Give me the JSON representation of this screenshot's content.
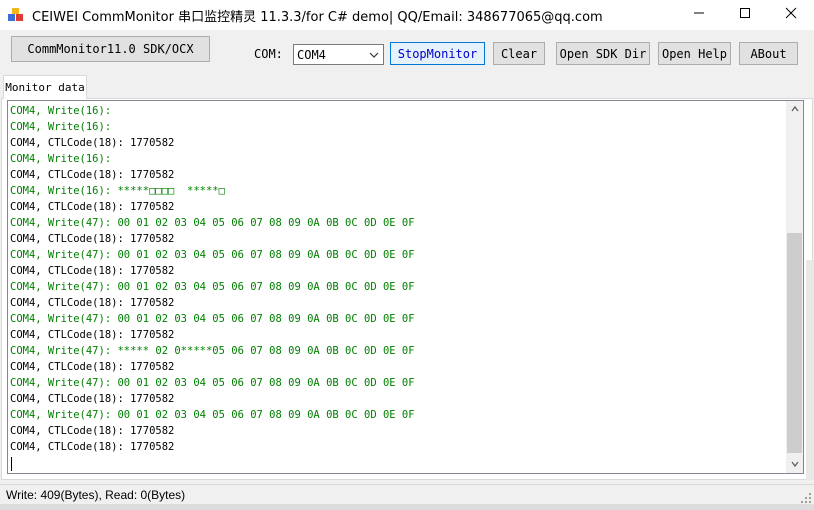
{
  "window": {
    "title": "CEIWEI CommMonitor 串口监控精灵 11.3.3/for C# demo| QQ/Email: 348677065@qq.com",
    "controls": [
      "minimize-icon",
      "maximize-icon",
      "close-icon"
    ]
  },
  "toolbar": {
    "sdk_label": "CommMonitor11.0 SDK/OCX",
    "com_label": "COM:",
    "com_value": "COM4",
    "stop_label": "StopMonitor",
    "clear_label": "Clear",
    "open_sdk_label": "Open SDK Dir",
    "help_label": "Open Help",
    "about_label": "ABout"
  },
  "tabs": [
    {
      "label": "Monitor data",
      "selected": true
    }
  ],
  "log": {
    "colors": {
      "write": "#008000",
      "ctl": "#000000"
    },
    "lines": [
      {
        "text": "COM4, Write(16):",
        "type": "write"
      },
      {
        "text": "COM4, Write(16):",
        "type": "write"
      },
      {
        "text": "COM4, CTLCode(18): 1770582",
        "type": "ctl"
      },
      {
        "text": "COM4, Write(16):",
        "type": "write"
      },
      {
        "text": "COM4, CTLCode(18): 1770582",
        "type": "ctl"
      },
      {
        "text": "COM4, Write(16): *****□□□□  *****□",
        "type": "write"
      },
      {
        "text": "COM4, CTLCode(18): 1770582",
        "type": "ctl"
      },
      {
        "text": "COM4, Write(47): 00 01 02 03 04 05 06 07 08 09 0A 0B 0C 0D 0E 0F",
        "type": "write"
      },
      {
        "text": "COM4, CTLCode(18): 1770582",
        "type": "ctl"
      },
      {
        "text": "COM4, Write(47): 00 01 02 03 04 05 06 07 08 09 0A 0B 0C 0D 0E 0F",
        "type": "write"
      },
      {
        "text": "COM4, CTLCode(18): 1770582",
        "type": "ctl"
      },
      {
        "text": "COM4, Write(47): 00 01 02 03 04 05 06 07 08 09 0A 0B 0C 0D 0E 0F",
        "type": "write"
      },
      {
        "text": "COM4, CTLCode(18): 1770582",
        "type": "ctl"
      },
      {
        "text": "COM4, Write(47): 00 01 02 03 04 05 06 07 08 09 0A 0B 0C 0D 0E 0F",
        "type": "write"
      },
      {
        "text": "COM4, CTLCode(18): 1770582",
        "type": "ctl"
      },
      {
        "text": "COM4, Write(47): ***** 02 0*****05 06 07 08 09 0A 0B 0C 0D 0E 0F",
        "type": "write"
      },
      {
        "text": "COM4, CTLCode(18): 1770582",
        "type": "ctl"
      },
      {
        "text": "COM4, Write(47): 00 01 02 03 04 05 06 07 08 09 0A 0B 0C 0D 0E 0F",
        "type": "write"
      },
      {
        "text": "COM4, CTLCode(18): 1770582",
        "type": "ctl"
      },
      {
        "text": "COM4, Write(47): 00 01 02 03 04 05 06 07 08 09 0A 0B 0C 0D 0E 0F",
        "type": "write"
      },
      {
        "text": "COM4, CTLCode(18): 1770582",
        "type": "ctl"
      },
      {
        "text": "COM4, CTLCode(18): 1770582",
        "type": "ctl"
      }
    ]
  },
  "status": {
    "text": "Write:  409(Bytes), Read: 0(Bytes)"
  }
}
